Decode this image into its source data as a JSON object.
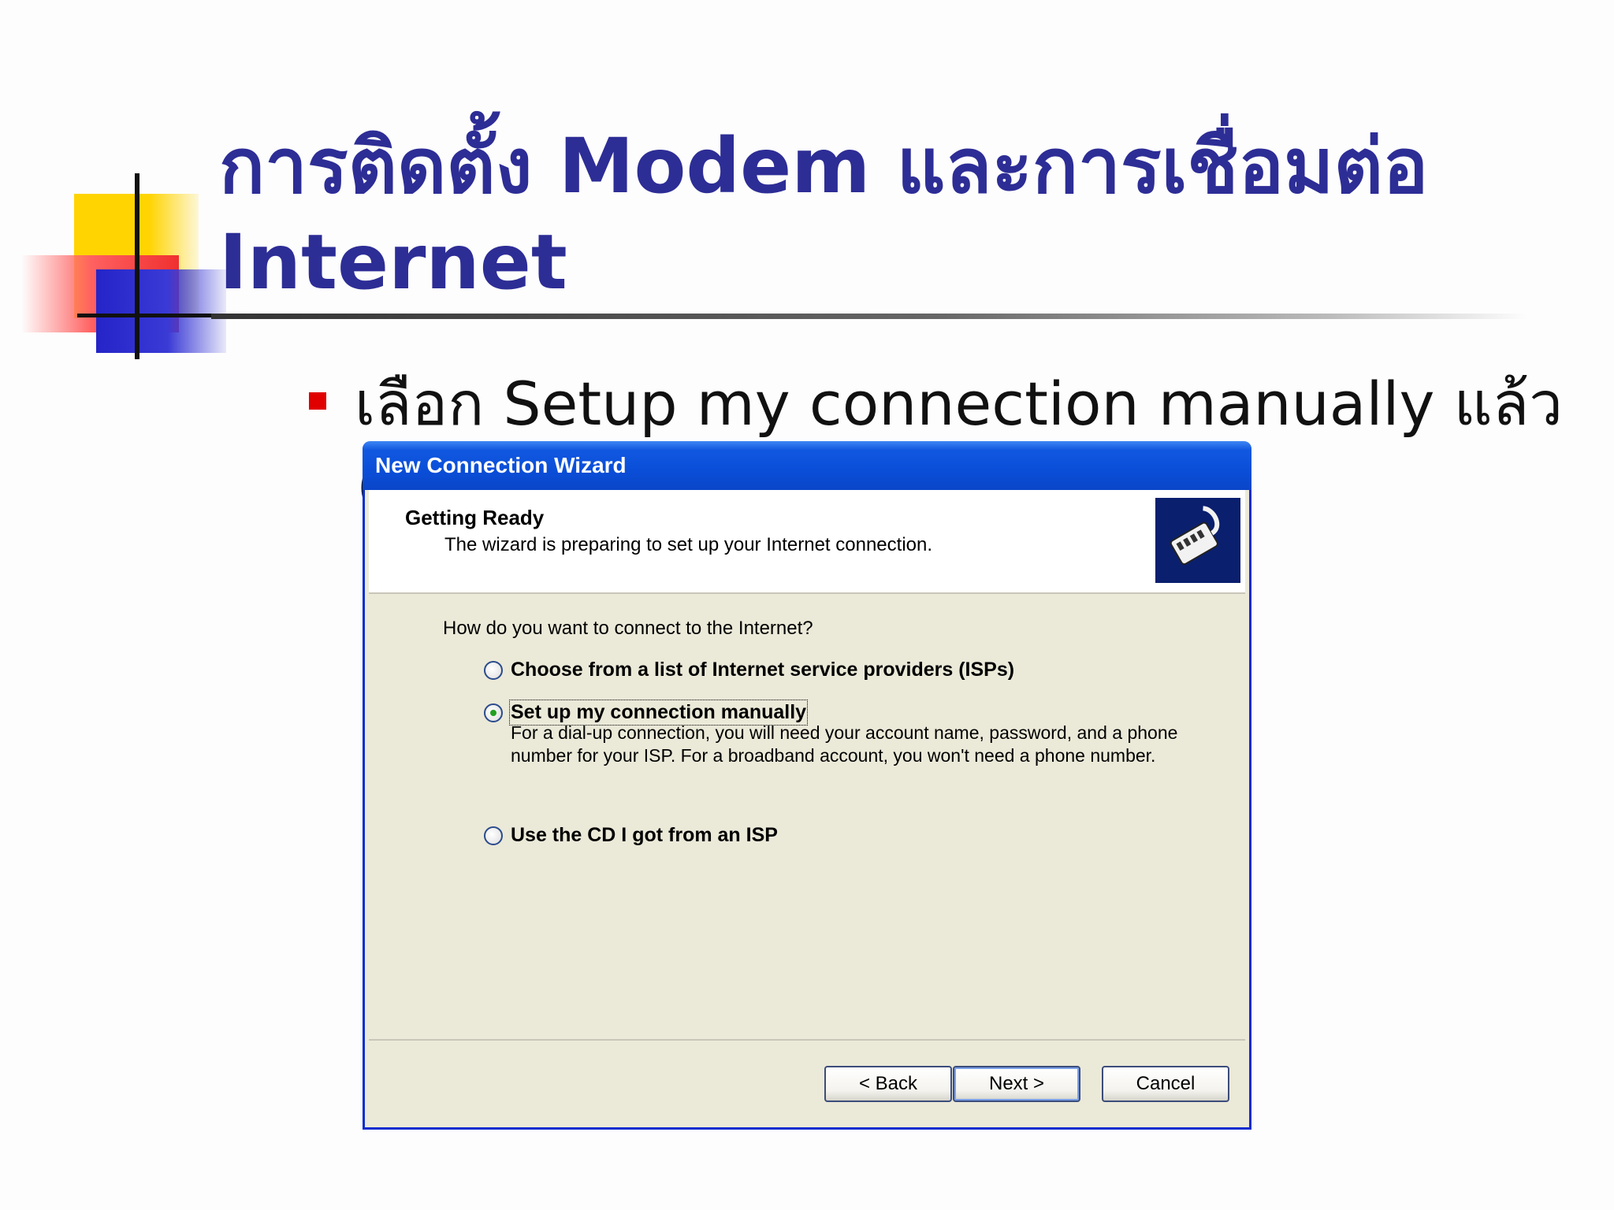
{
  "slide": {
    "title": "การติดตั้ง Modem และการเชื่อมต่อ Internet",
    "bullet": "เลือก Setup my connection manually แล้ว",
    "bullet_cont": "("
  },
  "dialog": {
    "title": "New Connection Wizard",
    "header_title": "Getting Ready",
    "header_subtitle": "The wizard is preparing to set up your Internet connection.",
    "question": "How do you want to connect to the Internet?",
    "options": [
      {
        "label": "Choose from a list of Internet service providers (ISPs)",
        "selected": false
      },
      {
        "label": "Set up my connection manually",
        "selected": true
      },
      {
        "label": "Use the CD I got from an ISP",
        "selected": false
      }
    ],
    "manual_description": "For a dial-up connection, you will need your account name, password, and a phone number for your ISP. For a broadband account, you won't need a phone number.",
    "buttons": {
      "back": "< Back",
      "next": "Next >",
      "cancel": "Cancel"
    }
  },
  "colors": {
    "title": "#2d2d96",
    "titlebar": "#0a4ed8",
    "dialog_bg": "#ebe9d8",
    "bullet": "#e00000"
  }
}
